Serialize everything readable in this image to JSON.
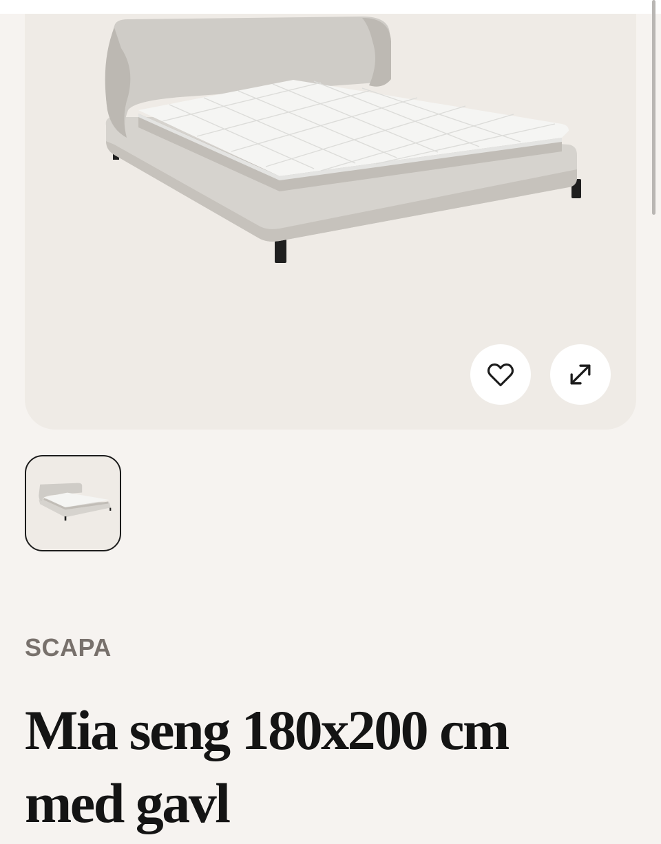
{
  "product": {
    "brand": "SCAPA",
    "title": "Mia seng 180x200 cm med gavl"
  },
  "gallery": {
    "image_alt": "Mia seng",
    "icons": [
      "heart-icon",
      "expand-icon"
    ],
    "thumbnail_count": 1,
    "selected_thumbnail": 1
  },
  "colors": {
    "background": "#f6f3f0",
    "gallery_bg": "#efebe6",
    "brand_text": "#78716c",
    "title_text": "#141414"
  }
}
